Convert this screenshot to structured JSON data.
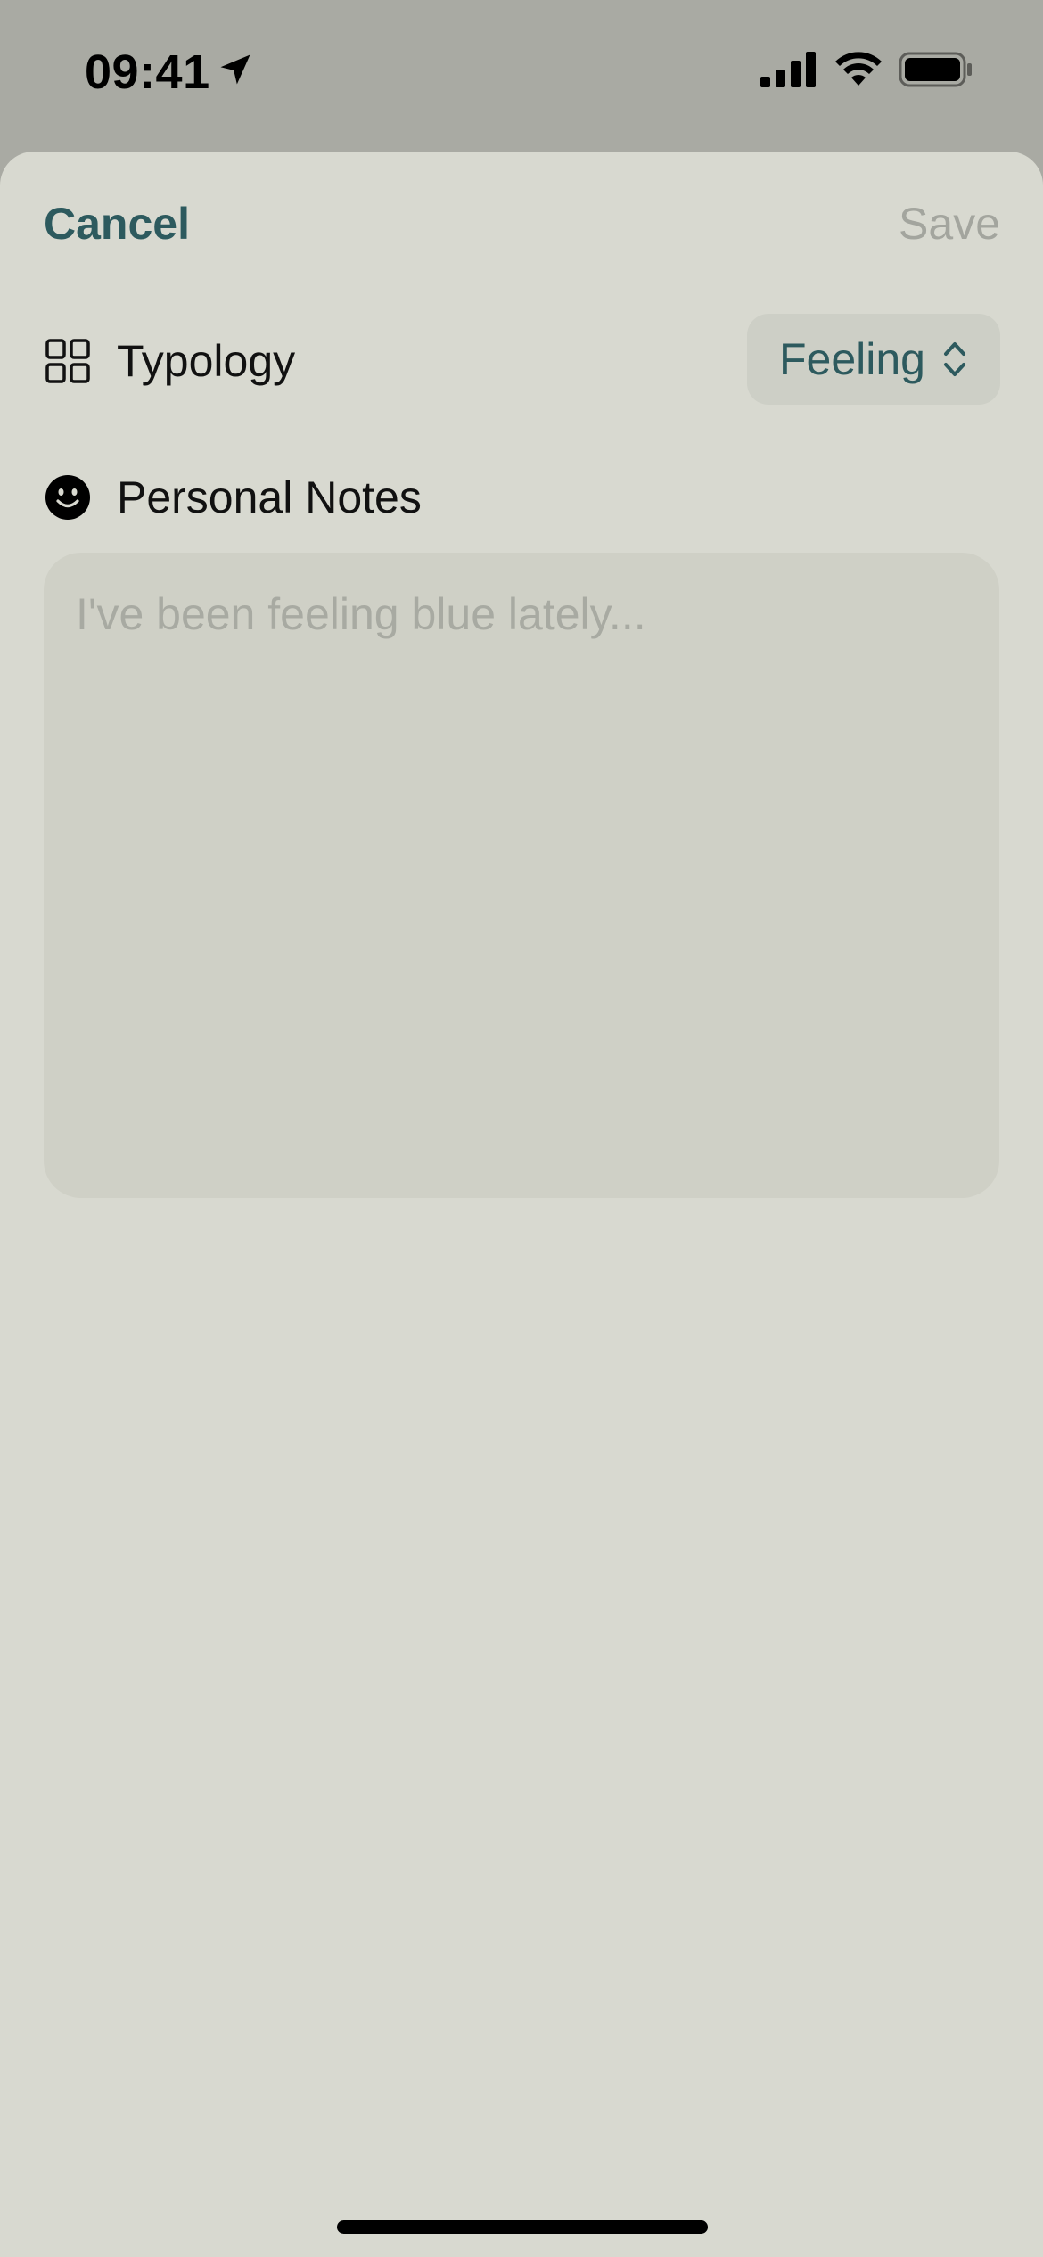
{
  "status_bar": {
    "time": "09:41",
    "icons": [
      "location-arrow-icon",
      "cellular-signal-icon",
      "wifi-icon",
      "battery-icon"
    ]
  },
  "header": {
    "cancel_label": "Cancel",
    "save_label": "Save"
  },
  "typology": {
    "icon": "grid-icon",
    "label": "Typology",
    "selected_value": "Feeling"
  },
  "notes": {
    "icon": "smiley-face-icon",
    "label": "Personal Notes",
    "value": "",
    "placeholder": "I've been feeling blue lately..."
  },
  "colors": {
    "accent": "#2d5a5e",
    "sheet_background": "#d8d9d0",
    "disabled_text": "#a3a59e"
  }
}
